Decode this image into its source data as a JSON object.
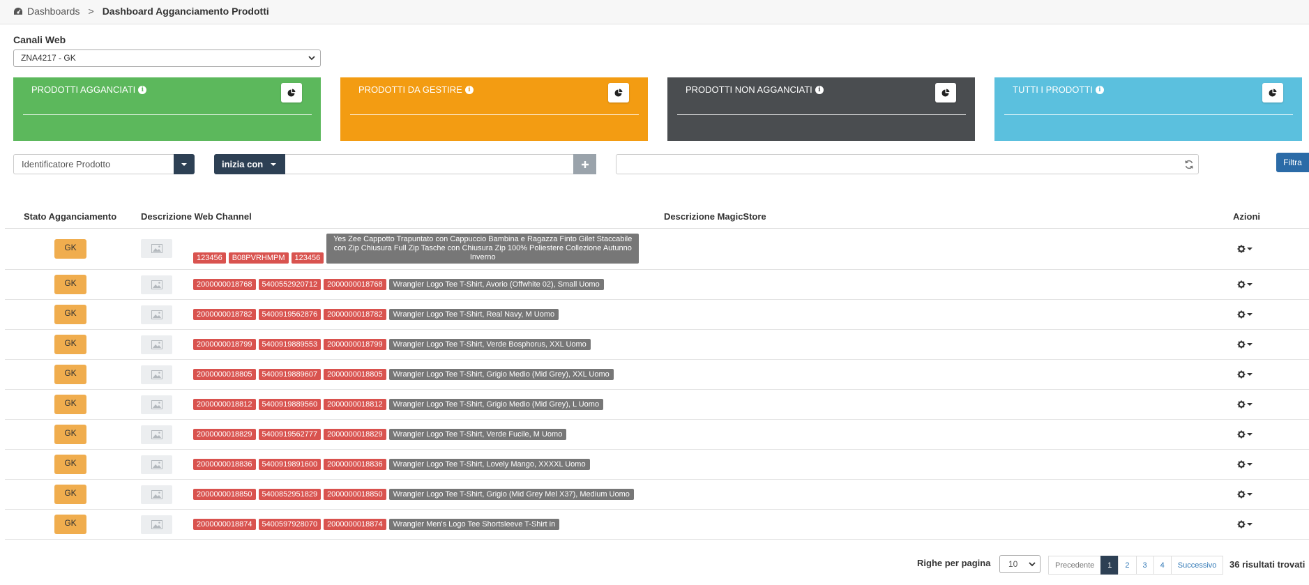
{
  "breadcrumb": {
    "root_label": "Dashboards",
    "separator": ">",
    "current_label": "Dashboard Agganciamento Prodotti",
    "icon": "dashboard-icon"
  },
  "channel": {
    "label": "Canali Web",
    "selected": "ZNA4217 - GK"
  },
  "cards": [
    {
      "title": "PRODOTTI AGGANCIATI",
      "color": "#5cb85c",
      "icon": "pie-chart-icon"
    },
    {
      "title": "PRODOTTI DA GESTIRE",
      "color": "#f39c12",
      "icon": "pie-chart-icon"
    },
    {
      "title": "PRODOTTI NON AGGANCIATI",
      "color": "#4a4d50",
      "icon": "pie-chart-icon"
    },
    {
      "title": "TUTTI I PRODOTTI",
      "color": "#5bc0de",
      "icon": "pie-chart-icon"
    }
  ],
  "filters": {
    "field_select": "Identificatore Prodotto",
    "operator": "inizia con",
    "value": "",
    "search": "",
    "filter_button": "Filtra"
  },
  "table": {
    "headers": {
      "stato": "Stato Agganciamento",
      "web": "Descrizione Web Channel",
      "magic": "Descrizione MagicStore",
      "azioni": "Azioni"
    },
    "rows": [
      {
        "stato": "GK",
        "codes": [
          "123456",
          "B08PVRHMPM",
          "123456"
        ],
        "desc": "Yes Zee Cappotto Trapuntato con Cappuccio Bambina e Ragazza Finto Gilet Staccabile con Zip Chiusura Full Zip Tasche con Chiusura Zip 100% Poliestere Collezione Autunno Inverno"
      },
      {
        "stato": "GK",
        "codes": [
          "2000000018768",
          "5400552920712",
          "2000000018768"
        ],
        "desc": "Wrangler Logo Tee T-Shirt, Avorio (Offwhite 02), Small Uomo"
      },
      {
        "stato": "GK",
        "codes": [
          "2000000018782",
          "5400919562876",
          "2000000018782"
        ],
        "desc": "Wrangler Logo Tee T-Shirt, Real Navy, M Uomo"
      },
      {
        "stato": "GK",
        "codes": [
          "2000000018799",
          "5400919889553",
          "2000000018799"
        ],
        "desc": "Wrangler Logo Tee T-Shirt, Verde Bosphorus, XXL Uomo"
      },
      {
        "stato": "GK",
        "codes": [
          "2000000018805",
          "5400919889607",
          "2000000018805"
        ],
        "desc": "Wrangler Logo Tee T-Shirt, Grigio Medio (Mid Grey), XXL Uomo"
      },
      {
        "stato": "GK",
        "codes": [
          "2000000018812",
          "5400919889560",
          "2000000018812"
        ],
        "desc": "Wrangler Logo Tee T-Shirt, Grigio Medio (Mid Grey), L Uomo"
      },
      {
        "stato": "GK",
        "codes": [
          "2000000018829",
          "5400919562777",
          "2000000018829"
        ],
        "desc": "Wrangler Logo Tee T-Shirt, Verde Fucile, M Uomo"
      },
      {
        "stato": "GK",
        "codes": [
          "2000000018836",
          "5400919891600",
          "2000000018836"
        ],
        "desc": "Wrangler Logo Tee T-Shirt, Lovely Mango, XXXXL Uomo"
      },
      {
        "stato": "GK",
        "codes": [
          "2000000018850",
          "5400852951829",
          "2000000018850"
        ],
        "desc": "Wrangler Logo Tee T-Shirt, Grigio (Mid Grey Mel X37), Medium Uomo"
      },
      {
        "stato": "GK",
        "codes": [
          "2000000018874",
          "5400597928070",
          "2000000018874"
        ],
        "desc": "Wrangler Men's Logo Tee Shortsleeve T-Shirt in"
      }
    ]
  },
  "pagination": {
    "rows_label": "Righe per pagina",
    "rows_value": "10",
    "prev": "Precedente",
    "pages": [
      "1",
      "2",
      "3",
      "4"
    ],
    "active_page": "1",
    "next": "Successivo",
    "results": "36 risultati trovati"
  },
  "colors": {
    "dark_navy": "#2d4054",
    "tag_red": "#d9534f",
    "tag_grey": "#777777",
    "status_orange": "#f0ad4e",
    "filter_blue": "#2b6ba7"
  }
}
